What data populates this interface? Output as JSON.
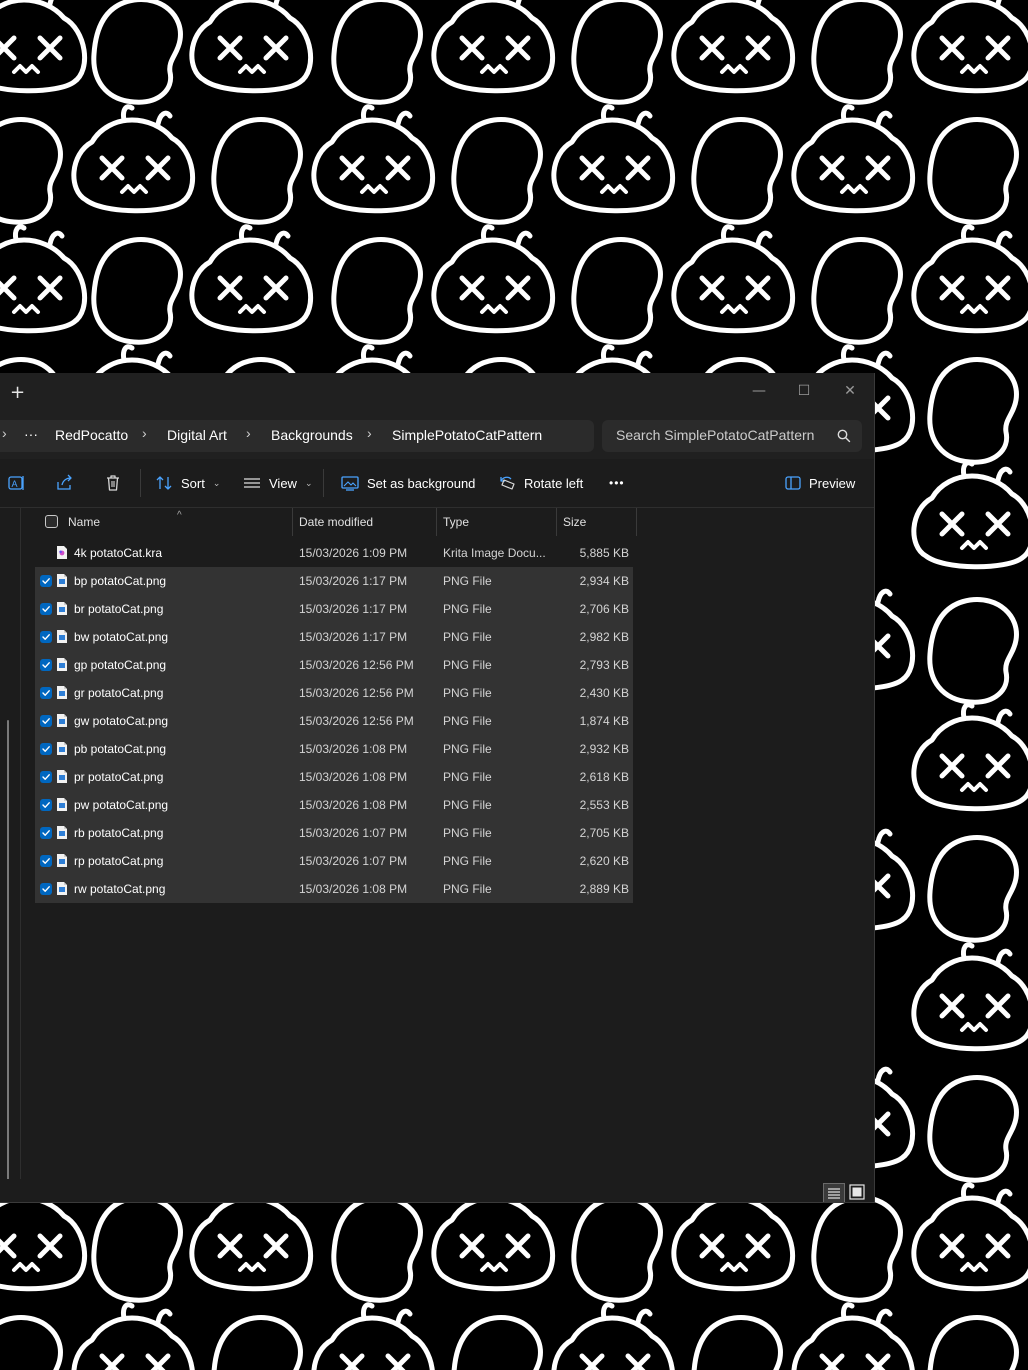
{
  "window": {
    "new_tab": "+",
    "controls": {
      "minimize": "—",
      "maximize": "☐",
      "close": "✕"
    }
  },
  "address": {
    "overflow": "···",
    "crumbs": [
      "RedPocatto",
      "Digital Art",
      "Backgrounds",
      "SimplePotatoCatPattern"
    ],
    "search_placeholder": "Search SimplePotatoCatPattern"
  },
  "toolbar": {
    "sort_label": "Sort",
    "view_label": "View",
    "set_background_label": "Set as background",
    "rotate_left_label": "Rotate left",
    "more_label": "•••",
    "preview_label": "Preview"
  },
  "columns": {
    "name": "Name",
    "date": "Date modified",
    "type": "Type",
    "size": "Size"
  },
  "files": [
    {
      "name": "4k potatoCat.kra",
      "date": "15/03/2026 1:09 PM",
      "type": "Krita Image Docu...",
      "size": "5,885 KB",
      "selected": false,
      "icon": "krita-file-icon"
    },
    {
      "name": "bp potatoCat.png",
      "date": "15/03/2026 1:17 PM",
      "type": "PNG File",
      "size": "2,934 KB",
      "selected": true,
      "icon": "png-file-icon"
    },
    {
      "name": "br potatoCat.png",
      "date": "15/03/2026 1:17 PM",
      "type": "PNG File",
      "size": "2,706 KB",
      "selected": true,
      "icon": "png-file-icon"
    },
    {
      "name": "bw potatoCat.png",
      "date": "15/03/2026 1:17 PM",
      "type": "PNG File",
      "size": "2,982 KB",
      "selected": true,
      "icon": "png-file-icon"
    },
    {
      "name": "gp potatoCat.png",
      "date": "15/03/2026 12:56 PM",
      "type": "PNG File",
      "size": "2,793 KB",
      "selected": true,
      "icon": "png-file-icon"
    },
    {
      "name": "gr potatoCat.png",
      "date": "15/03/2026 12:56 PM",
      "type": "PNG File",
      "size": "2,430 KB",
      "selected": true,
      "icon": "png-file-icon"
    },
    {
      "name": "gw potatoCat.png",
      "date": "15/03/2026 12:56 PM",
      "type": "PNG File",
      "size": "1,874 KB",
      "selected": true,
      "icon": "png-file-icon"
    },
    {
      "name": "pb potatoCat.png",
      "date": "15/03/2026 1:08 PM",
      "type": "PNG File",
      "size": "2,932 KB",
      "selected": true,
      "icon": "png-file-icon"
    },
    {
      "name": "pr potatoCat.png",
      "date": "15/03/2026 1:08 PM",
      "type": "PNG File",
      "size": "2,618 KB",
      "selected": true,
      "icon": "png-file-icon"
    },
    {
      "name": "pw potatoCat.png",
      "date": "15/03/2026 1:08 PM",
      "type": "PNG File",
      "size": "2,553 KB",
      "selected": true,
      "icon": "png-file-icon"
    },
    {
      "name": "rb potatoCat.png",
      "date": "15/03/2026 1:07 PM",
      "type": "PNG File",
      "size": "2,705 KB",
      "selected": true,
      "icon": "png-file-icon"
    },
    {
      "name": "rp potatoCat.png",
      "date": "15/03/2026 1:07 PM",
      "type": "PNG File",
      "size": "2,620 KB",
      "selected": true,
      "icon": "png-file-icon"
    },
    {
      "name": "rw potatoCat.png",
      "date": "15/03/2026 1:08 PM",
      "type": "PNG File",
      "size": "2,889 KB",
      "selected": true,
      "icon": "png-file-icon"
    }
  ],
  "colors": {
    "wallpaper_bg": "#000000",
    "wallpaper_line": "#ffffff",
    "window_bg": "#1c1c1c",
    "selected_row": "#333333",
    "accent_checkbox": "#0067c0"
  }
}
